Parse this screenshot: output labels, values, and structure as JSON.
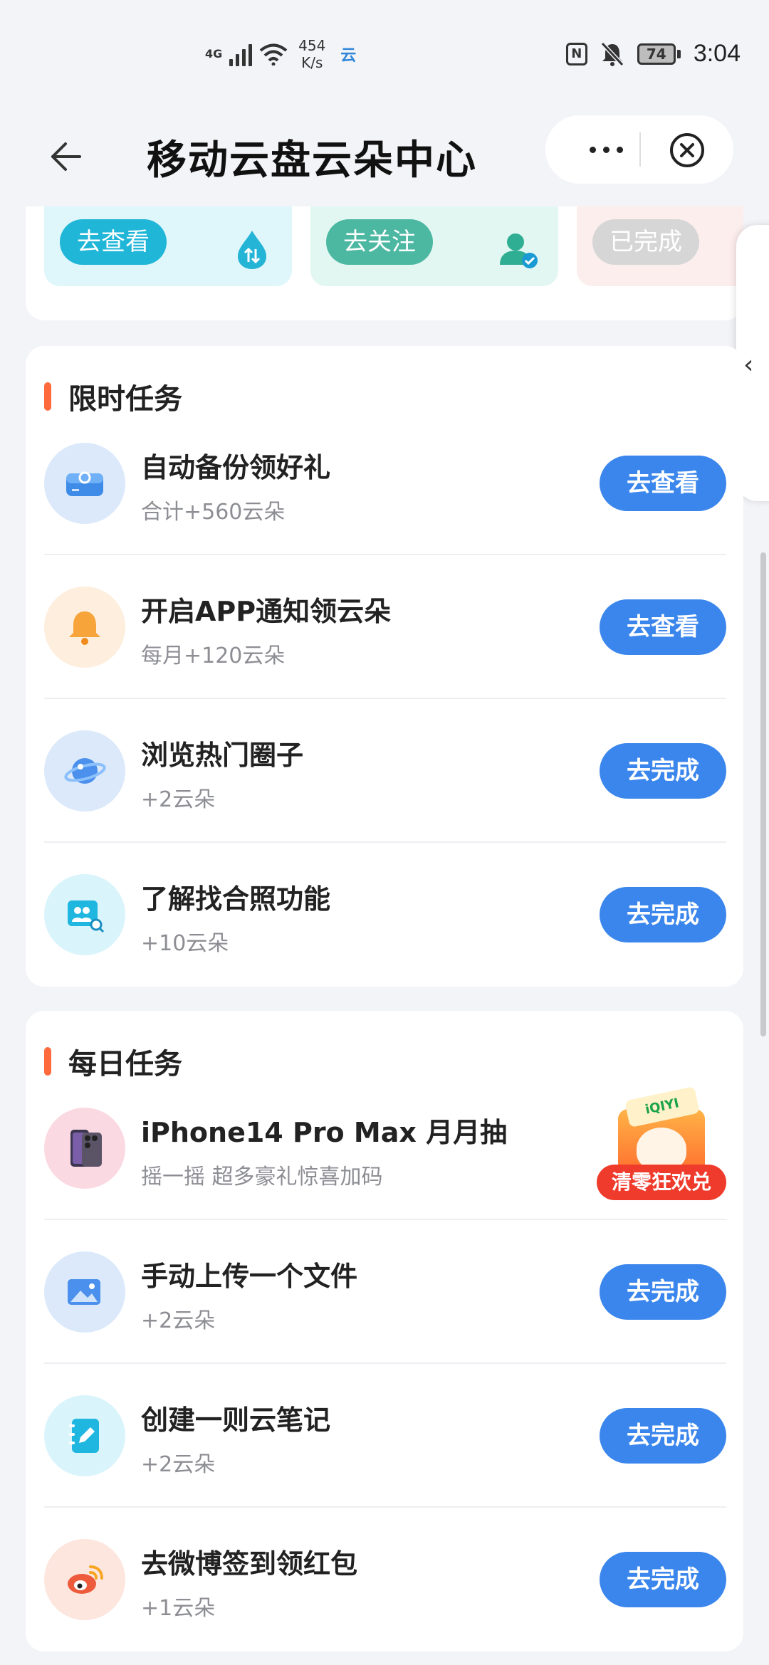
{
  "status_bar": {
    "network": "4G",
    "speed_value": "454",
    "speed_unit": "K/s",
    "cloud_glyph": "云",
    "nfc": "N",
    "battery": "74",
    "time": "3:04"
  },
  "header": {
    "title": "移动云盘云朵中心"
  },
  "top_tiles": [
    {
      "label": "去查看",
      "color": "#1fb6d8",
      "bg": "#dff6fb"
    },
    {
      "label": "去关注",
      "color": "#4cb8a2",
      "bg": "#e2f7f2"
    },
    {
      "label": "已完成",
      "color": "#d6d6d6",
      "bg": "#fdeeee"
    }
  ],
  "limited": {
    "title": "限时任务",
    "tasks": [
      {
        "title": "自动备份领好礼",
        "subtitle": "合计+560云朵",
        "button": "去查看",
        "icon": "backup-drive-icon",
        "icon_bg": "#dbe9fb"
      },
      {
        "title": "开启APP通知领云朵",
        "subtitle": "每月+120云朵",
        "button": "去查看",
        "icon": "bell-icon",
        "icon_bg": "#fdeedd"
      },
      {
        "title": "浏览热门圈子",
        "subtitle": "+2云朵",
        "button": "去完成",
        "icon": "planet-icon",
        "icon_bg": "#dbe9fb"
      },
      {
        "title": "了解找合照功能",
        "subtitle": "+10云朵",
        "button": "去完成",
        "icon": "group-photo-search-icon",
        "icon_bg": "#d9f4fb"
      }
    ]
  },
  "daily": {
    "title": "每日任务",
    "promo": {
      "title": "iPhone14 Pro Max 月月抽",
      "subtitle": "摇一摇 超多豪礼惊喜加码",
      "badge": "清零狂欢兑",
      "tag": "iQIYI"
    },
    "tasks": [
      {
        "title": "手动上传一个文件",
        "subtitle": "+2云朵",
        "button": "去完成",
        "icon": "image-upload-icon",
        "icon_bg": "#dbe9fb"
      },
      {
        "title": "创建一则云笔记",
        "subtitle": "+2云朵",
        "button": "去完成",
        "icon": "note-edit-icon",
        "icon_bg": "#d9f4fb"
      },
      {
        "title": "去微博签到领红包",
        "subtitle": "+1云朵",
        "button": "去完成",
        "icon": "weibo-icon",
        "icon_bg": "#fde6de"
      }
    ]
  }
}
